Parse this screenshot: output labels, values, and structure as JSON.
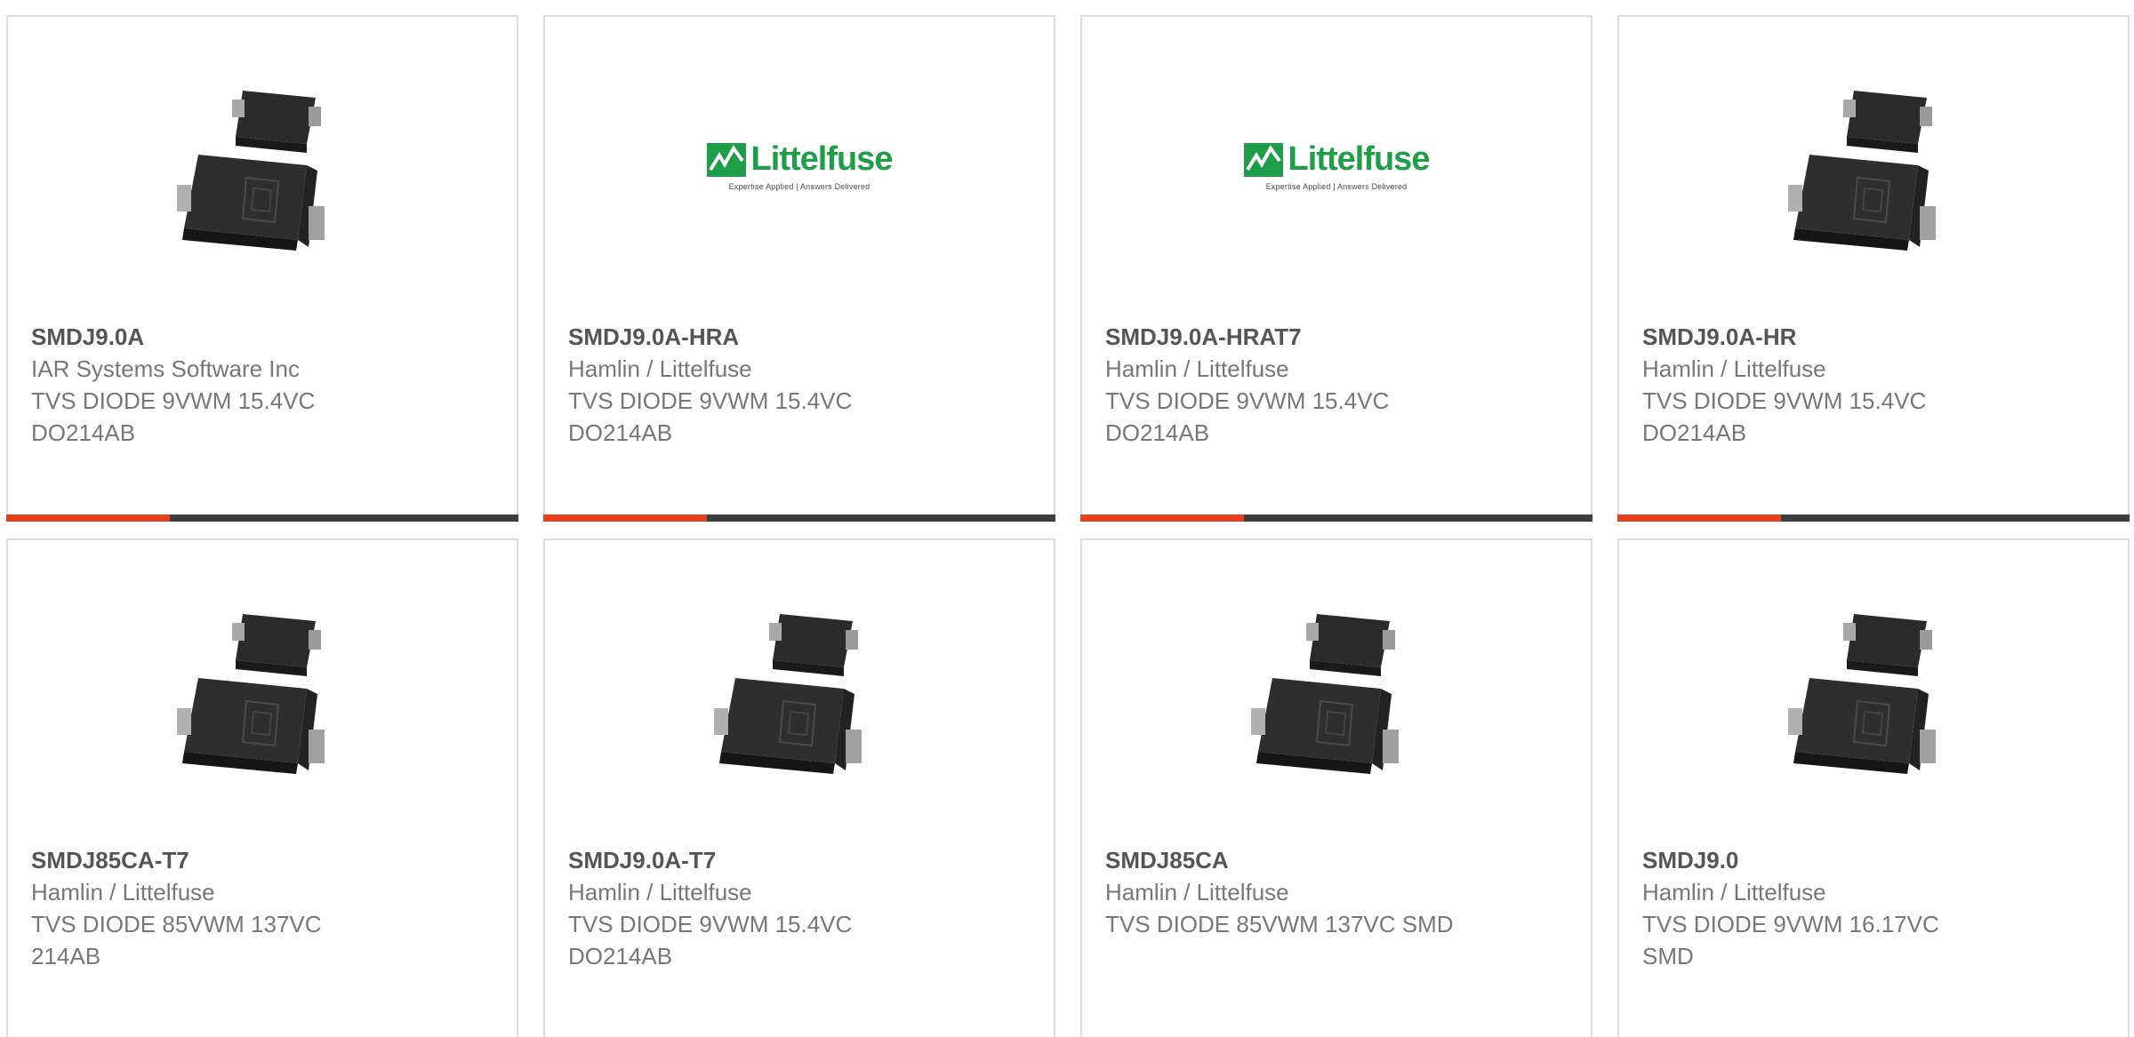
{
  "brand": {
    "accent_color": "#e8401c",
    "bar_color": "#3d3d3d",
    "logo_color": "#1f9e4a"
  },
  "logo": {
    "name": "Littelfuse",
    "tagline": "Expertise Applied | Answers Delivered"
  },
  "products": [
    {
      "part": "SMDJ9.0A",
      "manufacturer": "IAR Systems Software Inc",
      "desc1": "TVS DIODE 9VWM 15.4VC",
      "desc2": "DO214AB",
      "image": "diode-package",
      "progress": 0.32
    },
    {
      "part": "SMDJ9.0A-HRA",
      "manufacturer": "Hamlin / Littelfuse",
      "desc1": "TVS DIODE 9VWM 15.4VC",
      "desc2": "DO214AB",
      "image": "littelfuse-logo",
      "progress": 0.32
    },
    {
      "part": "SMDJ9.0A-HRAT7",
      "manufacturer": "Hamlin / Littelfuse",
      "desc1": "TVS DIODE 9VWM 15.4VC",
      "desc2": "DO214AB",
      "image": "littelfuse-logo",
      "progress": 0.32
    },
    {
      "part": "SMDJ9.0A-HR",
      "manufacturer": "Hamlin / Littelfuse",
      "desc1": "TVS DIODE 9VWM 15.4VC",
      "desc2": "DO214AB",
      "image": "diode-package",
      "progress": 0.32
    },
    {
      "part": "SMDJ85CA-T7",
      "manufacturer": "Hamlin / Littelfuse",
      "desc1": "TVS DIODE 85VWM 137VC",
      "desc2": "214AB",
      "image": "diode-package"
    },
    {
      "part": "SMDJ9.0A-T7",
      "manufacturer": "Hamlin / Littelfuse",
      "desc1": "TVS DIODE 9VWM 15.4VC",
      "desc2": "DO214AB",
      "image": "diode-package"
    },
    {
      "part": "SMDJ85CA",
      "manufacturer": "Hamlin / Littelfuse",
      "desc1": "TVS DIODE 85VWM 137VC SMD",
      "desc2": "",
      "image": "diode-package"
    },
    {
      "part": "SMDJ9.0",
      "manufacturer": "Hamlin / Littelfuse",
      "desc1": "TVS DIODE 9VWM 16.17VC",
      "desc2": "SMD",
      "image": "diode-package"
    }
  ]
}
